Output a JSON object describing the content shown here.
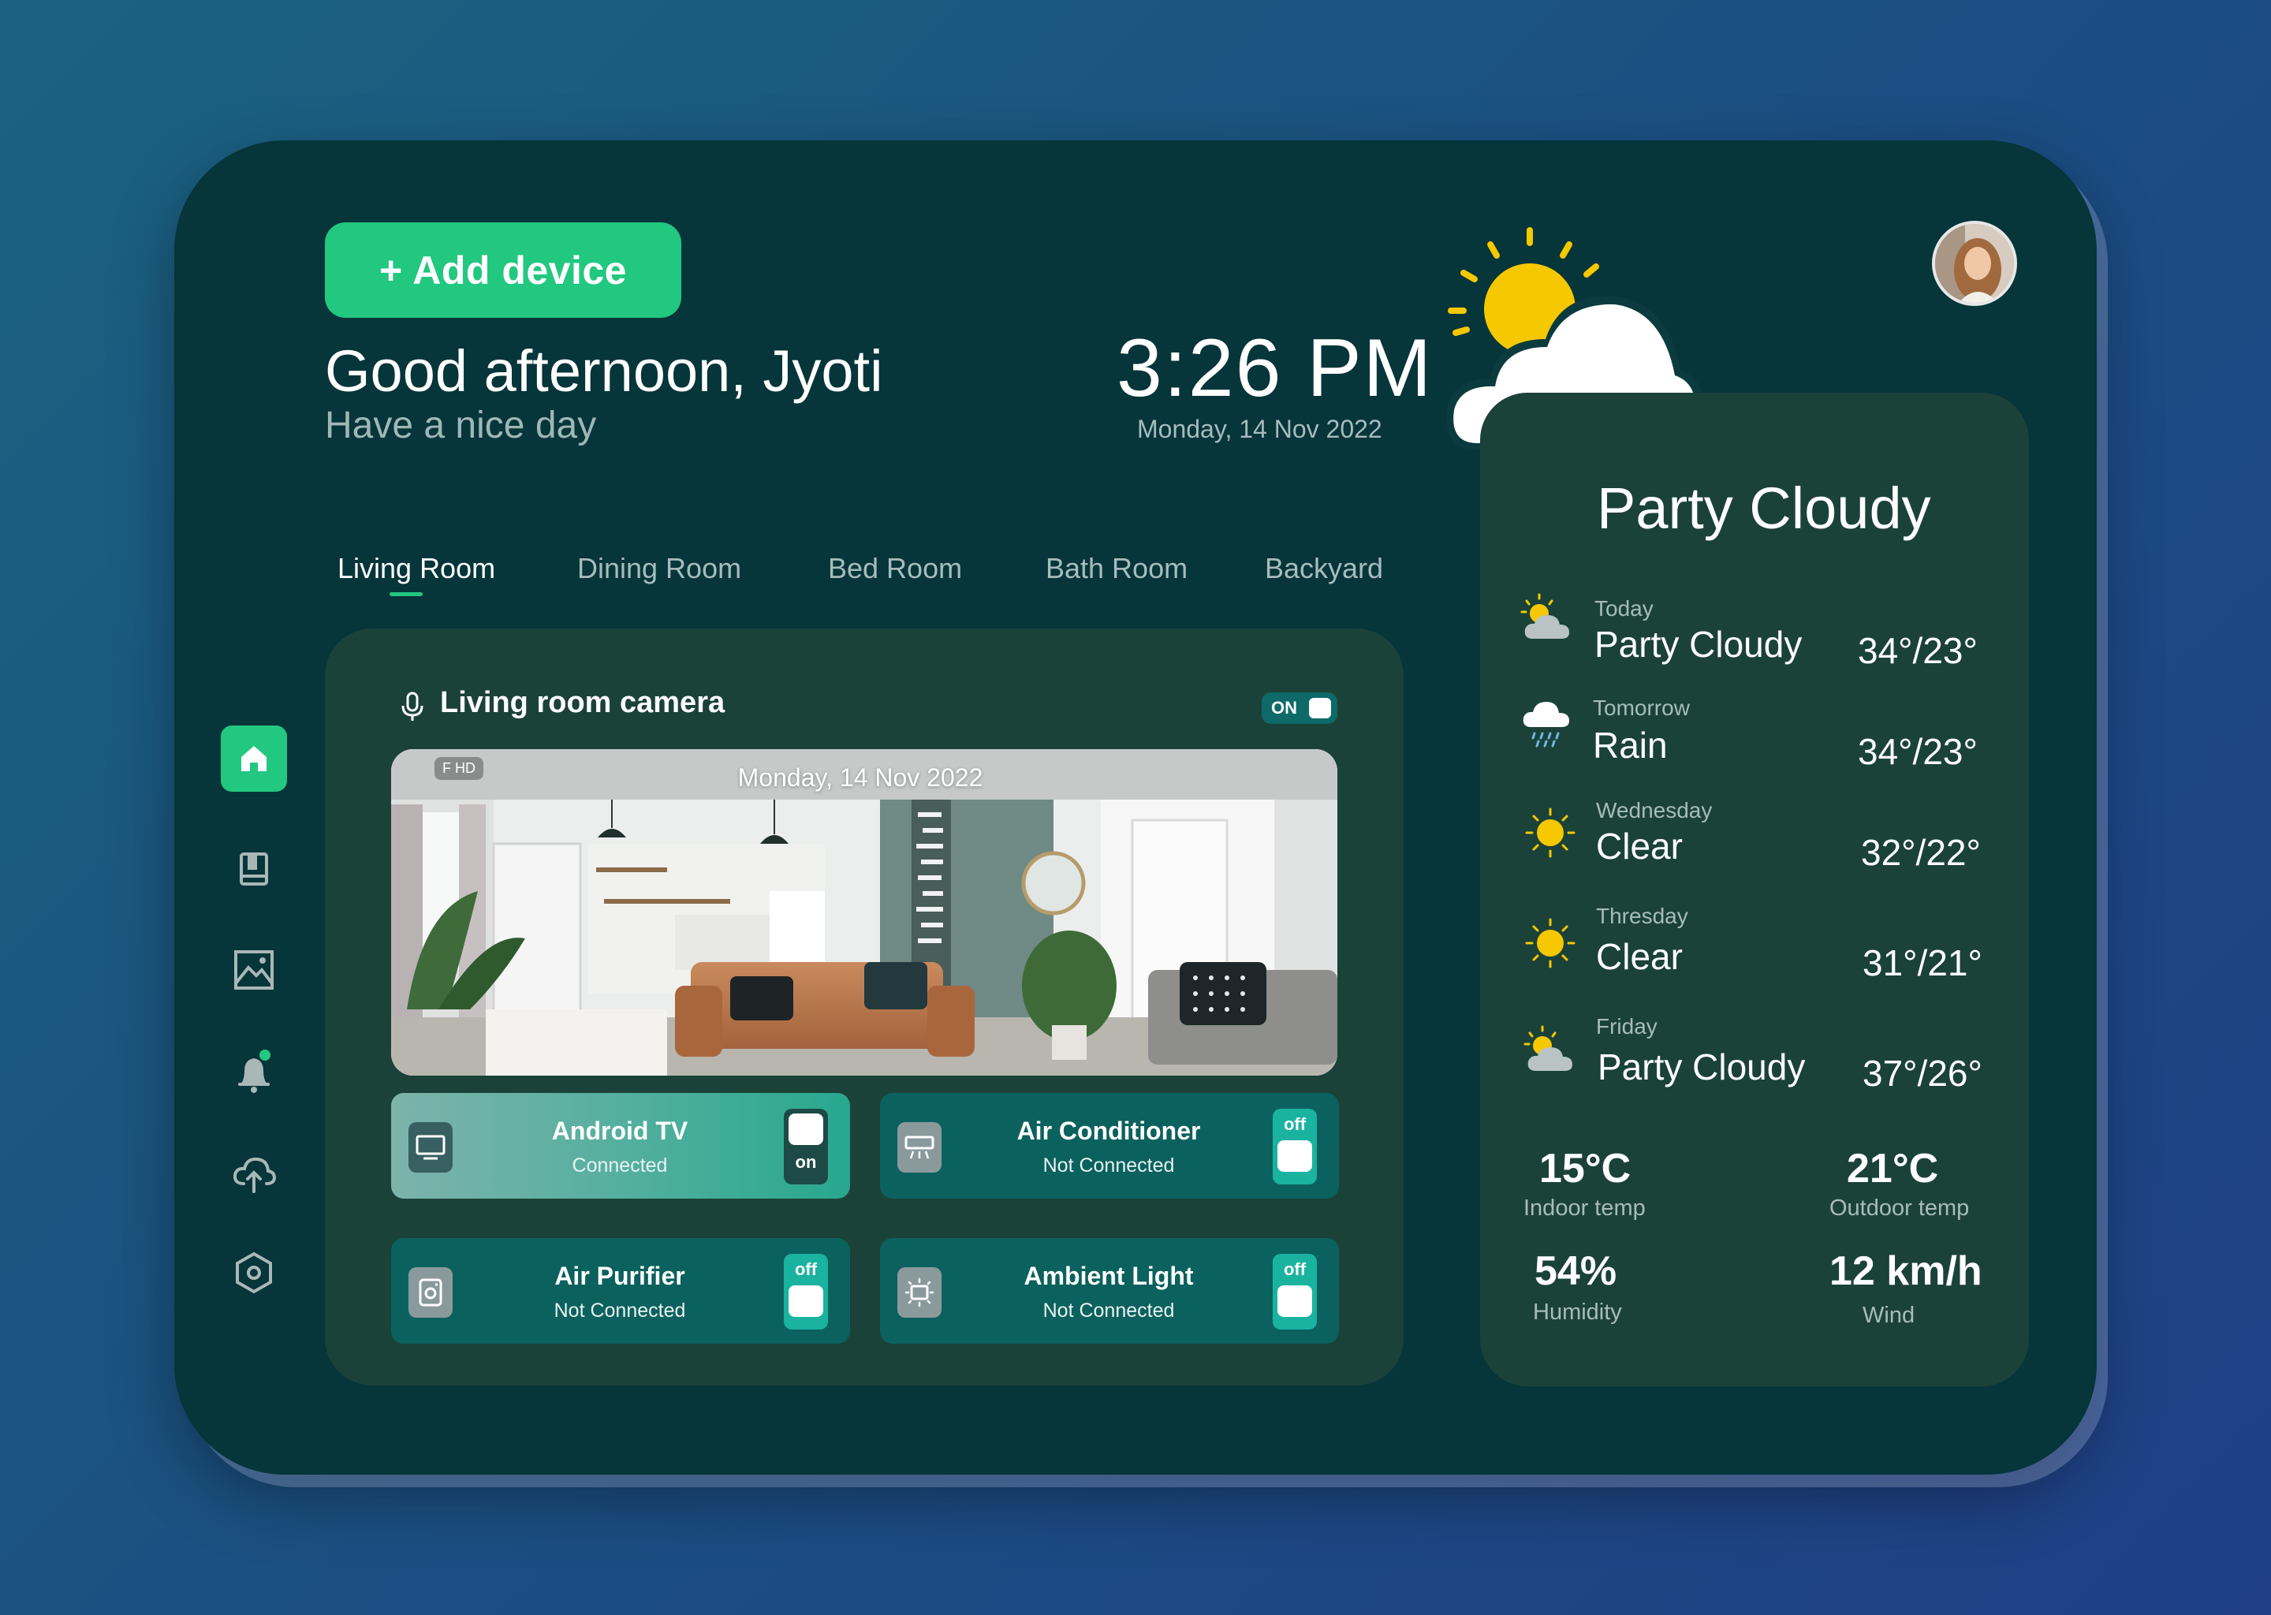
{
  "header": {
    "add_device_label": "+ Add device",
    "greeting": "Good afternoon, Jyoti",
    "subtitle": "Have a nice day",
    "time": "3:26 PM",
    "date": "Monday, 14 Nov 2022"
  },
  "tabs": [
    {
      "label": "Living Room",
      "active": true
    },
    {
      "label": "Dining Room",
      "active": false
    },
    {
      "label": "Bed Room",
      "active": false
    },
    {
      "label": "Bath Room",
      "active": false
    },
    {
      "label": "Backyard",
      "active": false
    }
  ],
  "sidebar": {
    "items": [
      {
        "icon": "home-icon",
        "active": true
      },
      {
        "icon": "book-icon",
        "active": false
      },
      {
        "icon": "image-icon",
        "active": false
      },
      {
        "icon": "bell-icon",
        "active": false
      },
      {
        "icon": "cloud-upload-icon",
        "active": false
      },
      {
        "icon": "settings-hex-icon",
        "active": false
      }
    ]
  },
  "camera": {
    "title": "Living room camera",
    "toggle_label": "ON",
    "overlay_date": "Monday, 14 Nov 2022",
    "quality_label": "F HD"
  },
  "devices": [
    {
      "name": "Android TV",
      "status": "Connected",
      "switch": "on",
      "icon": "tv-icon"
    },
    {
      "name": "Air Conditioner",
      "status": "Not Connected",
      "switch": "off",
      "icon": "air-conditioner-icon"
    },
    {
      "name": "Air Purifier",
      "status": "Not Connected",
      "switch": "off",
      "icon": "air-purifier-icon"
    },
    {
      "name": "Ambient Light",
      "status": "Not Connected",
      "switch": "off",
      "icon": "ambient-light-icon"
    }
  ],
  "weather": {
    "title": "Party Cloudy",
    "forecast": [
      {
        "day": "Today",
        "condition": "Party Cloudy",
        "temp": "34°/23°",
        "icon": "partly-cloudy-icon"
      },
      {
        "day": "Tomorrow",
        "condition": "Rain",
        "temp": "34°/23°",
        "icon": "rain-icon"
      },
      {
        "day": "Wednesday",
        "condition": "Clear",
        "temp": "32°/22°",
        "icon": "sun-icon"
      },
      {
        "day": "Thresday",
        "condition": "Clear",
        "temp": "31°/21°",
        "icon": "sun-icon"
      },
      {
        "day": "Friday",
        "condition": "Party Cloudy",
        "temp": "37°/26°",
        "icon": "partly-cloudy-icon"
      }
    ],
    "stats": {
      "indoor": {
        "value": "15°C",
        "label": "Indoor temp"
      },
      "outdoor": {
        "value": "21°C",
        "label": "Outdoor temp"
      },
      "humidity": {
        "value": "54%",
        "label": "Humidity"
      },
      "wind": {
        "value": "12 km/h",
        "label": "Wind"
      }
    }
  },
  "colors": {
    "accent": "#22c880",
    "panel": "#06353a",
    "card": "#1b4239",
    "device": "#0b615e",
    "sun": "#f6c800"
  }
}
